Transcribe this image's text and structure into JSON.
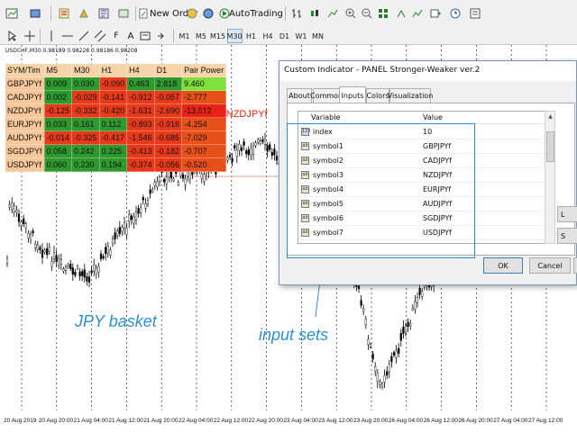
{
  "toolbar": {
    "new_order_label": "New Order",
    "autotrading_label": "AutoTrading",
    "timeframes": [
      "M1",
      "M5",
      "M15",
      "M30",
      "H1",
      "H4",
      "D1",
      "W1",
      "MN"
    ],
    "active_timeframe": "M30",
    "icons": [
      "new-chart-icon",
      "profiles-icon",
      "market-watch-icon",
      "data-window-icon",
      "navigator-icon",
      "terminal-icon",
      "strategy-tester-icon",
      "new-order-icon",
      "metaeditor-icon",
      "autotrading-icon",
      "bar-chart-icon",
      "candlestick-icon",
      "line-chart-icon",
      "zoom-in-icon",
      "zoom-out-icon",
      "tile-windows-icon",
      "autoscroll-icon",
      "chart-shift-icon",
      "indicators-icon",
      "periods-icon",
      "templates-icon",
      "cursor-icon",
      "crosshair-icon",
      "vertical-line-icon",
      "horizontal-line-icon",
      "trendline-icon",
      "equidistant-channel-icon",
      "fibonacci-icon",
      "text-icon",
      "text-label-icon",
      "arrows-icon"
    ]
  },
  "chart": {
    "header": "USDCHF,M30  0.98189 0.98228 0.98186 0.98208",
    "time_labels": [
      "20 Aug 2019",
      "20 Aug 20:00",
      "21 Aug 04:00",
      "21 Aug 12:00",
      "21 Aug 20:00",
      "22 Aug 04:00",
      "22 Aug 12:00",
      "22 Aug 20:00",
      "23 Aug 04:00",
      "23 Aug 12:00",
      "23 Aug 20:00",
      "26 Aug 04:00",
      "26 Aug 12:00",
      "26 Aug 20:00",
      "27 Aug 04:00",
      "27 Aug 12:00"
    ],
    "colors": {
      "bull_candle": "#000000",
      "grid": "#000000",
      "level_line": "#e8a090"
    }
  },
  "strength_table": {
    "headers": [
      "SYM/Tim",
      "M5",
      "M30",
      "H1",
      "H4",
      "D1",
      "Pair Power"
    ],
    "rows": [
      {
        "symbol": "GBPJPYf",
        "values": [
          "0.009",
          "0.030",
          "-0.090",
          "0.463",
          "2.818",
          "9.460"
        ],
        "colors": [
          "#2e9a2e",
          "#2e9a2e",
          "#e83a1a",
          "#2e9a2e",
          "#2e9a2e",
          "#7ee03a"
        ]
      },
      {
        "symbol": "CADJPYf",
        "values": [
          "0.002",
          "-0.029",
          "-0.141",
          "-0.912",
          "-0.057",
          "-2.777"
        ],
        "colors": [
          "#2e9a2e",
          "#e83a1a",
          "#e83a1a",
          "#e83a1a",
          "#e83a1a",
          "#e8501a"
        ]
      },
      {
        "symbol": "NZDJPYf",
        "values": [
          "-0.125",
          "-0.332",
          "-0.420",
          "-1.631",
          "-2.690",
          "-13.612"
        ],
        "colors": [
          "#e83a1a",
          "#e83a1a",
          "#e83a1a",
          "#e83a1a",
          "#e83a1a",
          "#e8231a"
        ]
      },
      {
        "symbol": "EURJPYf",
        "values": [
          "0.033",
          "0.161",
          "0.112",
          "-0.893",
          "-0.916",
          "-4.254"
        ],
        "colors": [
          "#2e9a2e",
          "#2e9a2e",
          "#2e9a2e",
          "#e83a1a",
          "#e83a1a",
          "#e8501a"
        ]
      },
      {
        "symbol": "AUDJPYf",
        "values": [
          "-0.014",
          "-0.325",
          "-0.417",
          "-1.546",
          "-0.685",
          "-7.029"
        ],
        "colors": [
          "#e83a1a",
          "#e83a1a",
          "#e83a1a",
          "#e83a1a",
          "#e83a1a",
          "#e8501a"
        ]
      },
      {
        "symbol": "SGDJPYf",
        "values": [
          "0.058",
          "0.242",
          "0.225",
          "-0.413",
          "-0.182",
          "-0.707"
        ],
        "colors": [
          "#2e9a2e",
          "#2e9a2e",
          "#2e9a2e",
          "#e83a1a",
          "#e83a1a",
          "#e8501a"
        ]
      },
      {
        "symbol": "USDJPYf",
        "values": [
          "0.060",
          "0.230",
          "0.194",
          "-0.374",
          "-0.056",
          "-0.520"
        ],
        "colors": [
          "#2e9a2e",
          "#2e9a2e",
          "#2e9a2e",
          "#e83a1a",
          "#e83a1a",
          "#e8501a"
        ]
      }
    ],
    "sell_note": "<--SELL: NZDJPYf"
  },
  "labels": {
    "basket": "JPY basket",
    "inputs": "input sets"
  },
  "dialog": {
    "title": "Custom Indicator - PANEL Stronger-Weaker ver.2",
    "tabs": [
      "About",
      "Common",
      "Inputs",
      "Colors",
      "Visualization"
    ],
    "active_tab": "Inputs",
    "columns": [
      "Variable",
      "Value"
    ],
    "rows": [
      {
        "icon": "number-icon",
        "icon_text": "123",
        "variable": "index",
        "value": "10"
      },
      {
        "icon": "string-icon",
        "icon_text": "ab",
        "variable": "symbol1",
        "value": "GBPJPYf"
      },
      {
        "icon": "string-icon",
        "icon_text": "ab",
        "variable": "symbol2",
        "value": "CADJPYf"
      },
      {
        "icon": "string-icon",
        "icon_text": "ab",
        "variable": "symbol3",
        "value": "NZDJPYf"
      },
      {
        "icon": "string-icon",
        "icon_text": "ab",
        "variable": "symbol4",
        "value": "EURJPYf"
      },
      {
        "icon": "string-icon",
        "icon_text": "ab",
        "variable": "symbol5",
        "value": "AUDJPYf"
      },
      {
        "icon": "string-icon",
        "icon_text": "ab",
        "variable": "symbol6",
        "value": "SGDJPYf"
      },
      {
        "icon": "string-icon",
        "icon_text": "ab",
        "variable": "symbol7",
        "value": "USDJPYf"
      }
    ],
    "side_buttons": [
      "L",
      "S"
    ],
    "ok_label": "OK",
    "cancel_label": "Cancel",
    "reset_label": "R"
  }
}
